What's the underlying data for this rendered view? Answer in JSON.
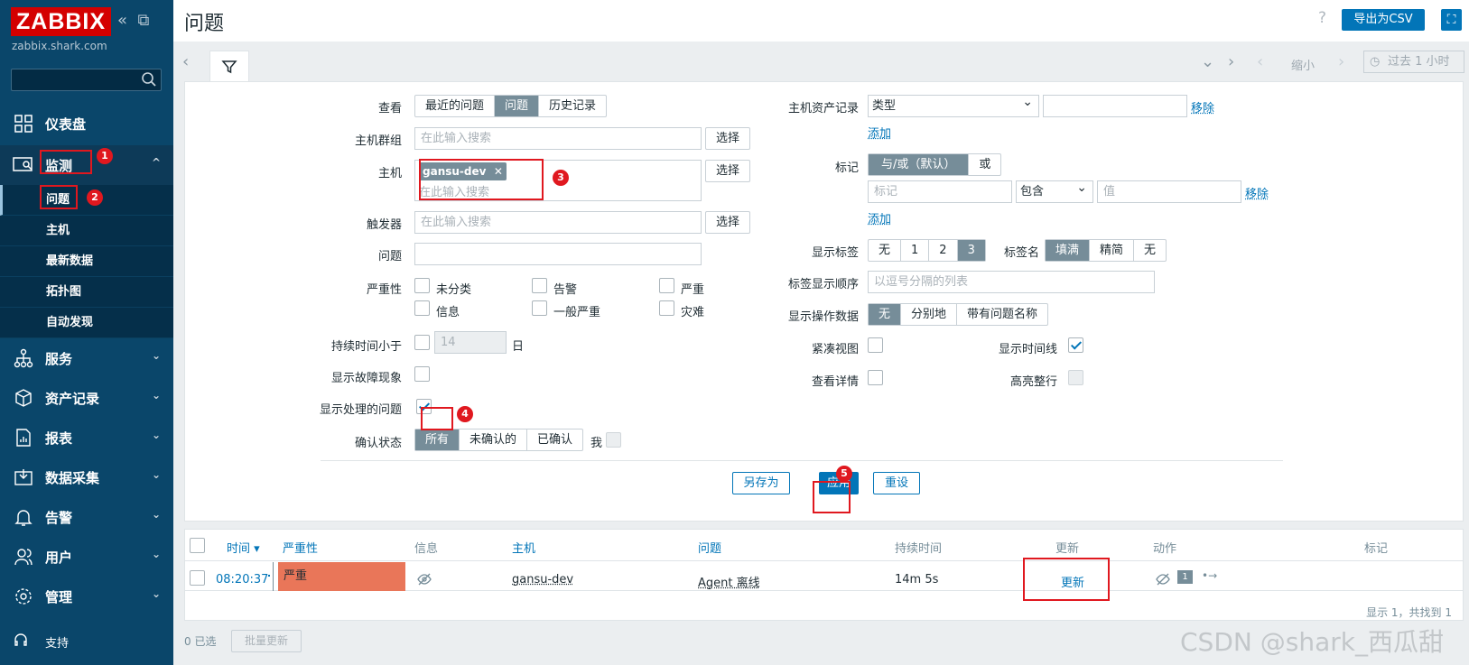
{
  "sidebar": {
    "logo": "ZABBIX",
    "server": "zabbix.shark.com",
    "menu": {
      "dashboard": "仪表盘",
      "monitoring": "监测",
      "services": "服务",
      "inventory": "资产记录",
      "reports": "报表",
      "datacollection": "数据采集",
      "alerts": "告警",
      "users": "用户",
      "admin": "管理",
      "support": "支持"
    },
    "submenu": [
      "问题",
      "主机",
      "最新数据",
      "拓扑图",
      "自动发现"
    ]
  },
  "header": {
    "title": "问题",
    "help": "?",
    "export": "导出为CSV"
  },
  "timebar": {
    "zoomout": "缩小",
    "period": "过去 1 小时"
  },
  "filter": {
    "view_label": "查看",
    "view_options": [
      "最近的问题",
      "问题",
      "历史记录"
    ],
    "hostgroup_label": "主机群组",
    "hostgroup_placeholder": "在此输入搜索",
    "select": "选择",
    "host_label": "主机",
    "host_tag": "gansu-dev",
    "host_placeholder": "在此输入搜索",
    "trigger_label": "触发器",
    "trigger_placeholder": "在此输入搜索",
    "problem_label": "问题",
    "severity_label": "严重性",
    "severities": [
      "未分类",
      "告警",
      "严重",
      "信息",
      "一般严重",
      "灾难"
    ],
    "age_label": "持续时间小于",
    "age_value": "14",
    "age_unit": "日",
    "symptoms_label": "显示故障现象",
    "suppressed_label": "显示处理的问题",
    "ack_label": "确认状态",
    "ack_options": [
      "所有",
      "未确认的",
      "已确认"
    ],
    "ack_me": "我",
    "inventory_label": "主机资产记录",
    "inventory_select": "类型",
    "remove": "移除",
    "add": "添加",
    "tags_label": "标记",
    "tags_options": [
      "与/或（默认）",
      "或"
    ],
    "tag_placeholder": "标记",
    "tag_op": "包含",
    "value_placeholder": "值",
    "show_tags_label": "显示标签",
    "show_tags_options": [
      "无",
      "1",
      "2",
      "3"
    ],
    "tagname_label": "标签名",
    "tagname_options": [
      "填满",
      "精简",
      "无"
    ],
    "tagorder_label": "标签显示顺序",
    "tagorder_placeholder": "以逗号分隔的列表",
    "opdata_label": "显示操作数据",
    "opdata_options": [
      "无",
      "分别地",
      "带有问题名称"
    ],
    "compact_label": "紧凑视图",
    "timeline_label": "显示时间线",
    "details_label": "查看详情",
    "highlight_label": "高亮整行",
    "saveas": "另存为",
    "apply": "应用",
    "reset": "重设"
  },
  "table": {
    "headers": [
      "时间 ▾",
      "严重性",
      "信息",
      "主机",
      "问题",
      "持续时间",
      "更新",
      "动作",
      "标记"
    ],
    "rows": [
      {
        "time": "08:20:37",
        "severity": "严重",
        "host": "gansu-dev",
        "problem": "Agent 离线",
        "duration": "14m 5s",
        "update": "更新",
        "msgcount": "1"
      }
    ],
    "footer": "显示 1，共找到 1"
  },
  "bottom": {
    "selected": "0 已选",
    "mass_update": "批量更新"
  },
  "annotations": [
    "1",
    "2",
    "3",
    "4",
    "5"
  ],
  "watermark": "CSDN @shark_西瓜甜",
  "colors": {
    "sidebar": "#0a466a",
    "accent": "#0275b8",
    "severity_high": "#e97659",
    "annotation": "#e0181f"
  }
}
